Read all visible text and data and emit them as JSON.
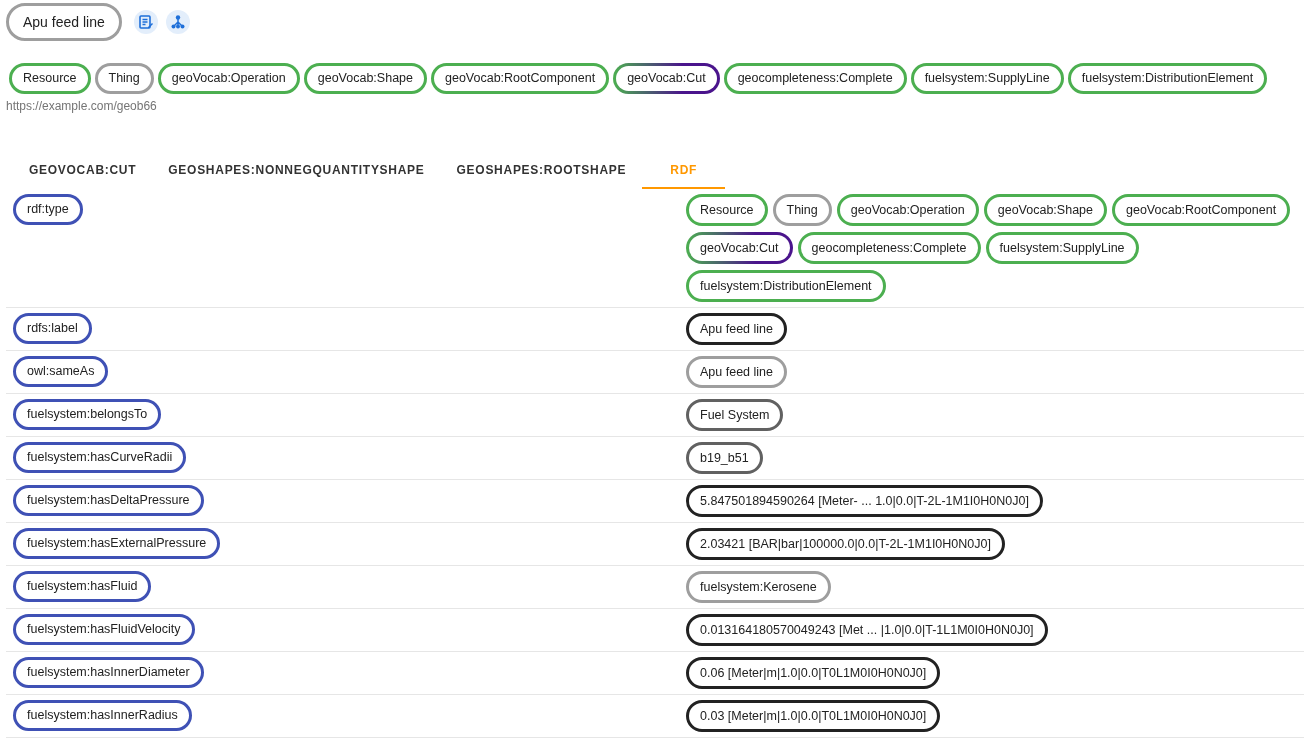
{
  "header": {
    "title": "Apu feed line"
  },
  "types": [
    {
      "label": "Resource",
      "color": "#4caf50"
    },
    {
      "label": "Thing",
      "color": "#9e9e9e"
    },
    {
      "label": "geoVocab:Operation",
      "color": "#4caf50"
    },
    {
      "label": "geoVocab:Shape",
      "color": "#4caf50"
    },
    {
      "label": "geoVocab:RootComponent",
      "color": "#4caf50"
    },
    {
      "label": "geoVocab:Cut",
      "color": "#4a148c",
      "kind": "blend"
    },
    {
      "label": "geocompleteness:Complete",
      "color": "#4caf50"
    },
    {
      "label": "fuelsystem:SupplyLine",
      "color": "#4caf50"
    },
    {
      "label": "fuelsystem:DistributionElement",
      "color": "#4caf50"
    }
  ],
  "uri": "https://example.com/geob66",
  "tabs": [
    {
      "label": "GEOVOCAB:CUT",
      "selected": false
    },
    {
      "label": "GEOSHAPES:NONNEGQUANTITYSHAPE",
      "selected": false
    },
    {
      "label": "GEOSHAPES:ROOTSHAPE",
      "selected": false
    },
    {
      "label": "RDF",
      "selected": true
    }
  ],
  "rows": [
    {
      "property": "rdf:type",
      "values": [
        {
          "label": "Resource",
          "color": "#4caf50"
        },
        {
          "label": "Thing",
          "color": "#9e9e9e"
        },
        {
          "label": "geoVocab:Operation",
          "color": "#4caf50"
        },
        {
          "label": "geoVocab:Shape",
          "color": "#4caf50"
        },
        {
          "label": "geoVocab:RootComponent",
          "color": "#4caf50"
        },
        {
          "label": "geoVocab:Cut",
          "color": "#4a148c",
          "kind": "blend"
        },
        {
          "label": "geocompleteness:Complete",
          "color": "#4caf50"
        },
        {
          "label": "fuelsystem:SupplyLine",
          "color": "#4caf50"
        },
        {
          "label": "fuelsystem:DistributionElement",
          "color": "#4caf50"
        }
      ]
    },
    {
      "property": "rdfs:label",
      "values": [
        {
          "label": "Apu feed line",
          "color": "#222222"
        }
      ]
    },
    {
      "property": "owl:sameAs",
      "values": [
        {
          "label": "Apu feed line",
          "color": "#9e9e9e"
        }
      ]
    },
    {
      "property": "fuelsystem:belongsTo",
      "values": [
        {
          "label": "Fuel System",
          "color": "#616161"
        }
      ]
    },
    {
      "property": "fuelsystem:hasCurveRadii",
      "values": [
        {
          "label": "b19_b51",
          "color": "#616161"
        }
      ]
    },
    {
      "property": "fuelsystem:hasDeltaPressure",
      "values": [
        {
          "label": "5.847501894590264 [Meter- ... 1.0|0.0|T-2L-1M1I0H0N0J0]",
          "color": "#222222"
        }
      ]
    },
    {
      "property": "fuelsystem:hasExternalPressure",
      "values": [
        {
          "label": "2.03421 [BAR|bar|100000.0|0.0|T-2L-1M1I0H0N0J0]",
          "color": "#222222"
        }
      ]
    },
    {
      "property": "fuelsystem:hasFluid",
      "values": [
        {
          "label": "fuelsystem:Kerosene",
          "color": "#9e9e9e"
        }
      ]
    },
    {
      "property": "fuelsystem:hasFluidVelocity",
      "values": [
        {
          "label": "0.013164180570049243 [Met ... |1.0|0.0|T-1L1M0I0H0N0J0]",
          "color": "#222222"
        }
      ]
    },
    {
      "property": "fuelsystem:hasInnerDiameter",
      "values": [
        {
          "label": "0.06 [Meter|m|1.0|0.0|T0L1M0I0H0N0J0]",
          "color": "#222222"
        }
      ]
    },
    {
      "property": "fuelsystem:hasInnerRadius",
      "values": [
        {
          "label": "0.03 [Meter|m|1.0|0.0|T0L1M0I0H0N0J0]",
          "color": "#222222"
        }
      ]
    }
  ]
}
